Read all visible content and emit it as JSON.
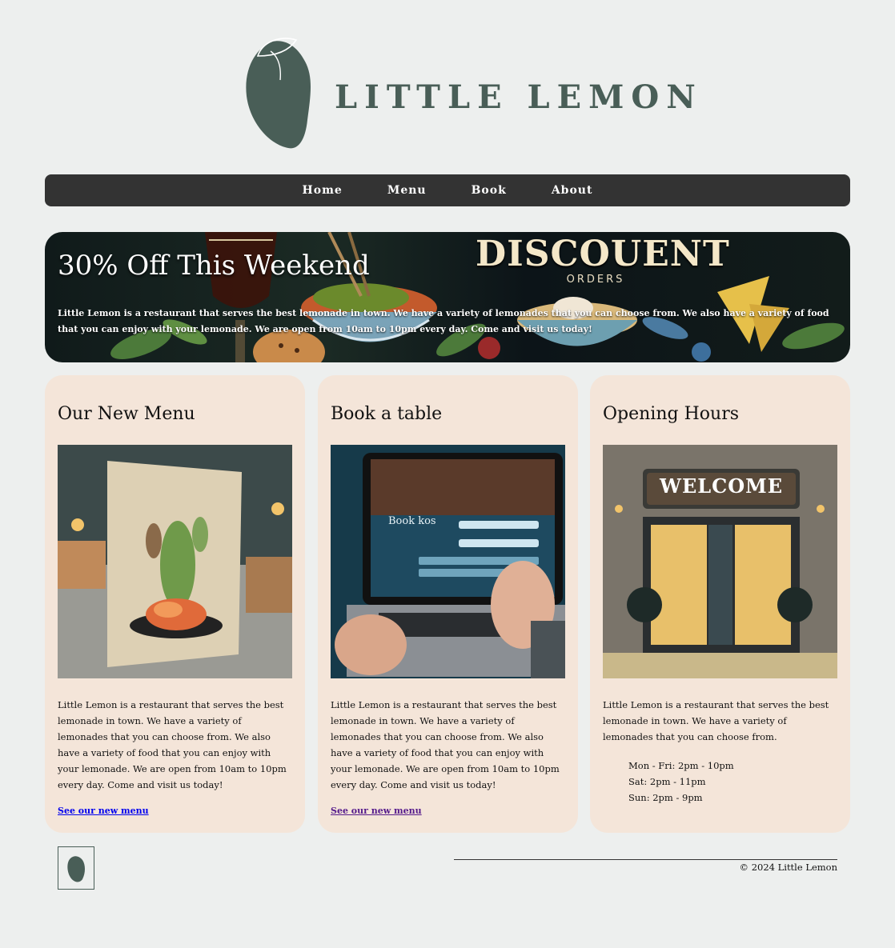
{
  "brand": {
    "name": "LITTLE LEMON",
    "color": "#495e57"
  },
  "nav": {
    "items": [
      "Home",
      "Menu",
      "Book",
      "About"
    ]
  },
  "hero": {
    "title": "30% Off This Weekend",
    "text": "Little Lemon is a restaurant that serves the best lemonade in town. We have a variety of lemonades that you can choose from. We also have a variety of food that you can enjoy with your lemonade. We are open from 10am to 10pm every day. Come and visit us today!",
    "image_heading": "DISCOUENT",
    "image_subheading": "ORDERS"
  },
  "cards": [
    {
      "title": "Our New Menu",
      "image": "menu-dish-image",
      "text": "Little Lemon is a restaurant that serves the best lemonade in town. We have a variety of lemonades that you can choose from. We also have a variety of food that you can enjoy with your lemonade. We are open from 10am to 10pm every day. Come and visit us today!",
      "link": "See our new menu"
    },
    {
      "title": "Book a table",
      "image": "laptop-booking-image",
      "image_text": "Book kos",
      "text": "Little Lemon is a restaurant that serves the best lemonade in town. We have a variety of lemonades that you can choose from. We also have a variety of food that you can enjoy with your lemonade. We are open from 10am to 10pm every day. Come and visit us today!",
      "link": "See our new menu"
    },
    {
      "title": "Opening Hours",
      "image": "storefront-image",
      "image_text": "WELCOME",
      "text": "Little Lemon is a restaurant that serves the best lemonade in town. We have a variety of lemonades that you can choose from.",
      "hours": [
        "Mon - Fri: 2pm - 10pm",
        "Sat: 2pm - 11pm",
        "Sun: 2pm - 9pm"
      ]
    }
  ],
  "footer": {
    "copyright": "© 2024 Little Lemon"
  }
}
